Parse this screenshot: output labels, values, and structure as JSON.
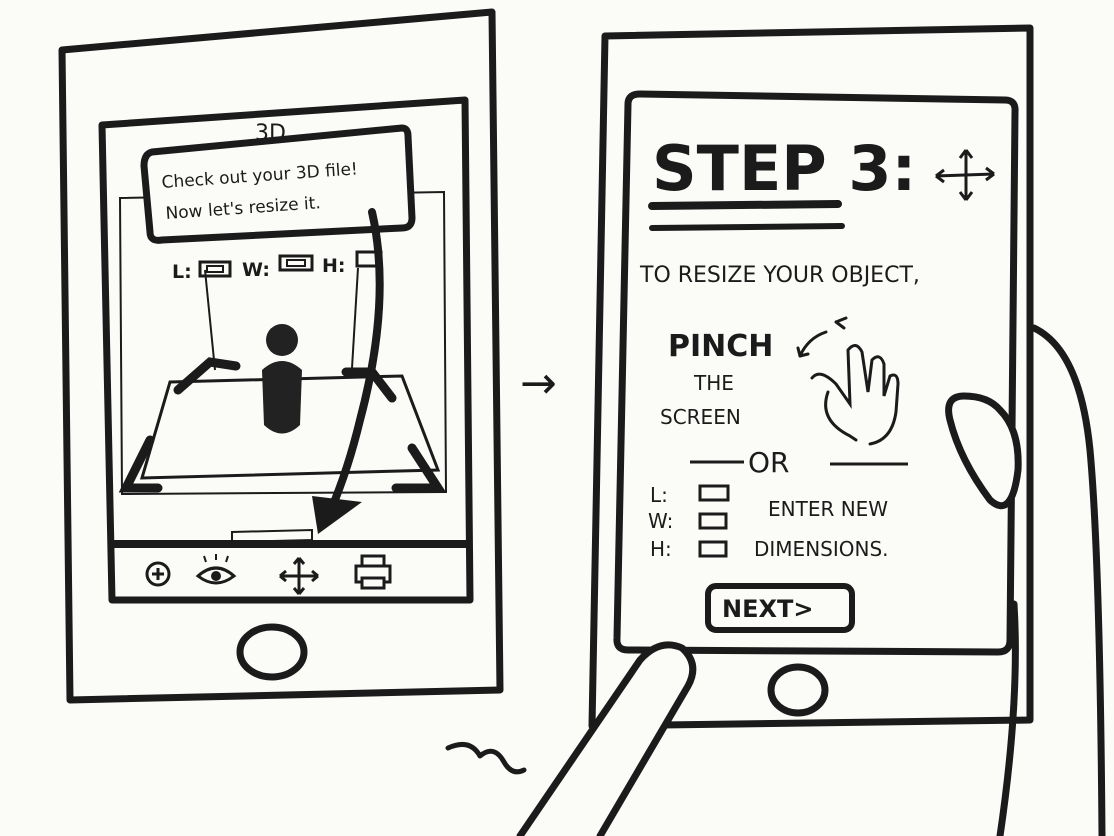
{
  "left_phone": {
    "header_label": "3D",
    "tooltip": {
      "line1": "Check out your 3D file!",
      "line2": "Now let's resize it."
    },
    "dimension_labels": {
      "length": "L:",
      "width": "W:",
      "height": "H:"
    },
    "toolbar_icons": [
      "add-icon",
      "eye-icon",
      "move-icon",
      "printer-icon"
    ]
  },
  "transition_arrow": "→",
  "right_phone": {
    "title": "STEP 3:",
    "instruction": "TO RESIZE YOUR OBJECT,",
    "pinch": {
      "word": "PINCH",
      "line2": "THE",
      "line3": "SCREEN"
    },
    "divider": "OR",
    "fields": {
      "length": "L:",
      "width": "W:",
      "height": "H:"
    },
    "enter_new": {
      "line1": "ENTER NEW",
      "line2": "DIMENSIONS."
    },
    "next_button": "NEXT>"
  },
  "colors": {
    "ink": "#1b1b1b",
    "paper": "#fbfbf8",
    "figure": "#222222"
  }
}
